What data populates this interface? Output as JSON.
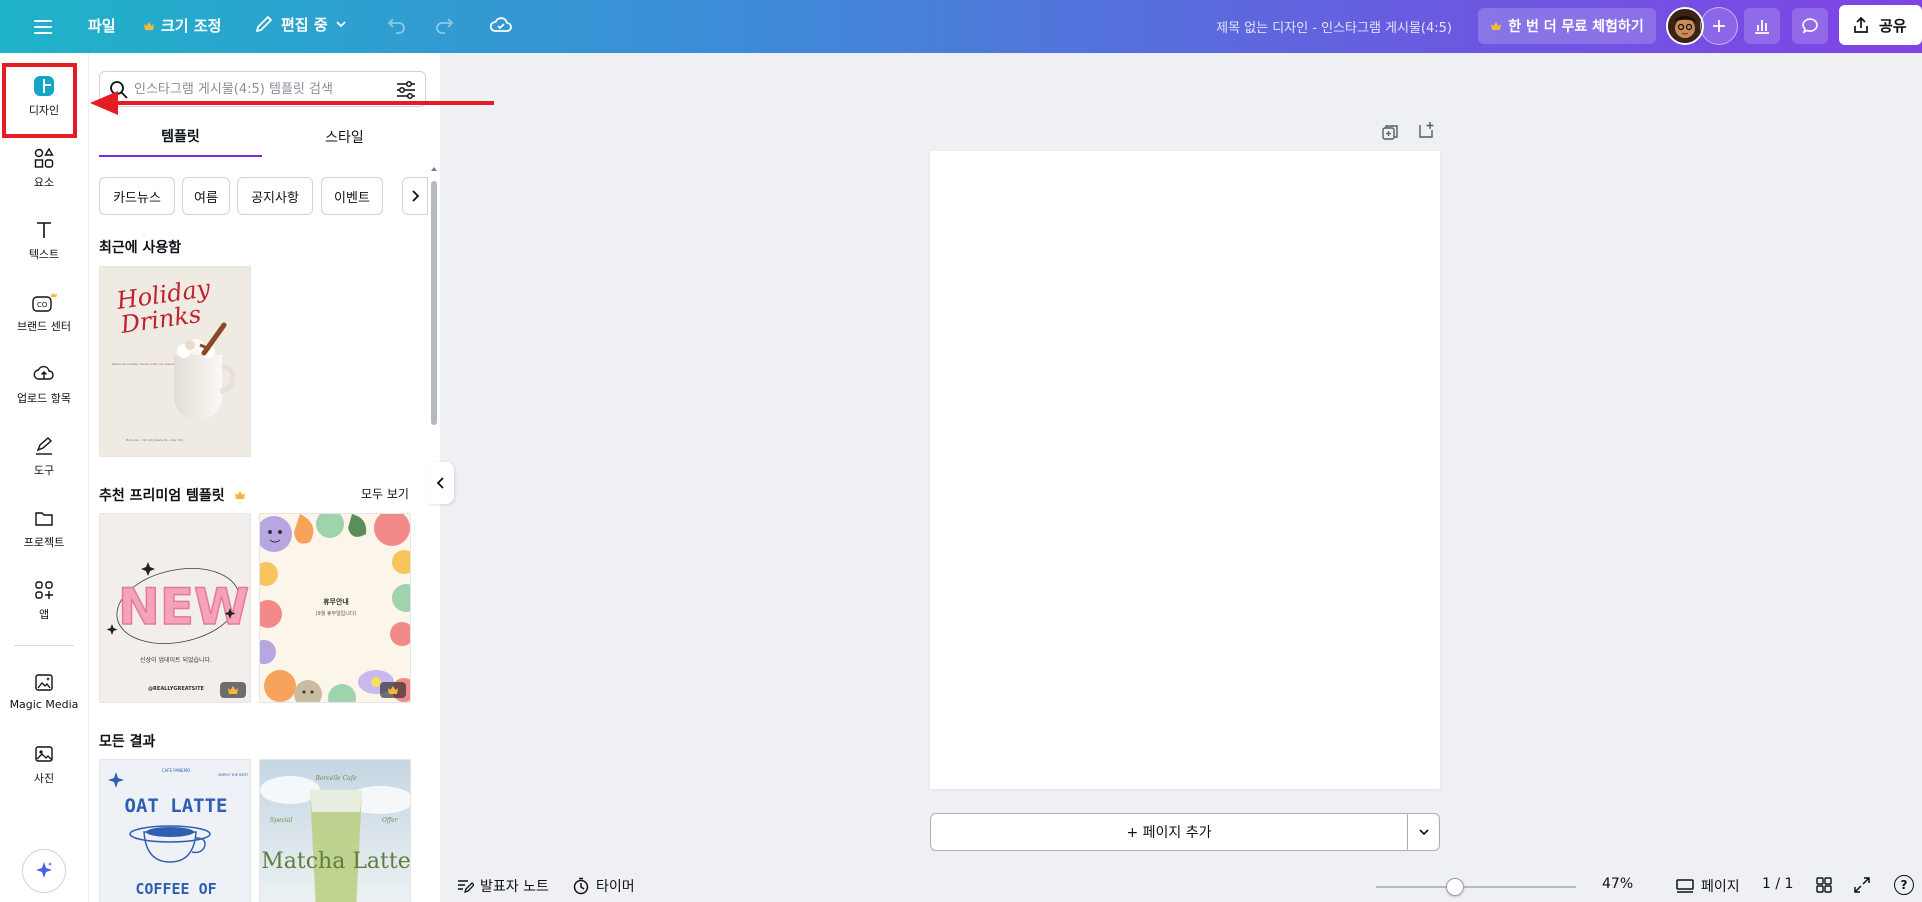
{
  "topbar": {
    "file": "파일",
    "resize": "크기 조정",
    "edit_mode": "편집 중",
    "doc_title": "제목 없는 디자인 - 인스타그램 게시물(4:5)",
    "trial": "한 번 더 무료 체험하기",
    "share": "공유"
  },
  "rail": {
    "items": [
      {
        "label": "디자인",
        "icon": "design-icon"
      },
      {
        "label": "요소",
        "icon": "elements-icon"
      },
      {
        "label": "텍스트",
        "icon": "text-icon"
      },
      {
        "label": "브랜드 센터",
        "icon": "brand-icon"
      },
      {
        "label": "업로드 항목",
        "icon": "upload-icon"
      },
      {
        "label": "도구",
        "icon": "draw-icon"
      },
      {
        "label": "프로젝트",
        "icon": "folder-icon"
      },
      {
        "label": "앱",
        "icon": "apps-icon"
      },
      {
        "label": "Magic Media",
        "icon": "magic-media-icon"
      },
      {
        "label": "사진",
        "icon": "photo-icon"
      }
    ]
  },
  "panel": {
    "search_placeholder": "인스타그램 게시물(4:5) 템플릿 검색",
    "tabs": [
      "템플릿",
      "스타일"
    ],
    "chips": [
      "카드뉴스",
      "여름",
      "공지사항",
      "이벤트"
    ],
    "recent_title": "최근에 사용함",
    "premium_title": "추천 프리미엄 템플릿",
    "see_all": "모두 보기",
    "all_title": "모든 결과",
    "thumbs": {
      "holiday": {
        "line1": "Holiday",
        "line2": "Drinks",
        "sub": "share the holiday cheers with our seasonal drinks",
        "foot": "Borcelle · 123 Anywhere St., Any City"
      },
      "new": {
        "word": "NEW",
        "sub": "신상이 업데이트 되었습니다.",
        "foot": "@REALLYGREATSITE"
      },
      "notice": {
        "title": "휴무안내",
        "sub": "(9월 휴무일입니다)"
      },
      "oat": {
        "top": "CAFE PANEMO",
        "right": "SIMPLY THE BEST",
        "line1": "OAT LATTE",
        "line2": "COFFEE OF"
      },
      "matcha": {
        "top": "Borcelle Cafe",
        "left": "Special",
        "right": "Offer",
        "title": "Matcha Latte"
      }
    }
  },
  "canvas": {
    "add_page": "+ 페이지 추가"
  },
  "bottom": {
    "notes": "발표자 노트",
    "timer": "타이머",
    "zoom": "47%",
    "zoom_level": 0.47,
    "pages_label": "페이지",
    "page_count": "1 / 1",
    "help": "?"
  },
  "colors": {
    "accent": "#7d2ae8",
    "crown": "#f5b93a",
    "annotation": "#e51c23"
  }
}
